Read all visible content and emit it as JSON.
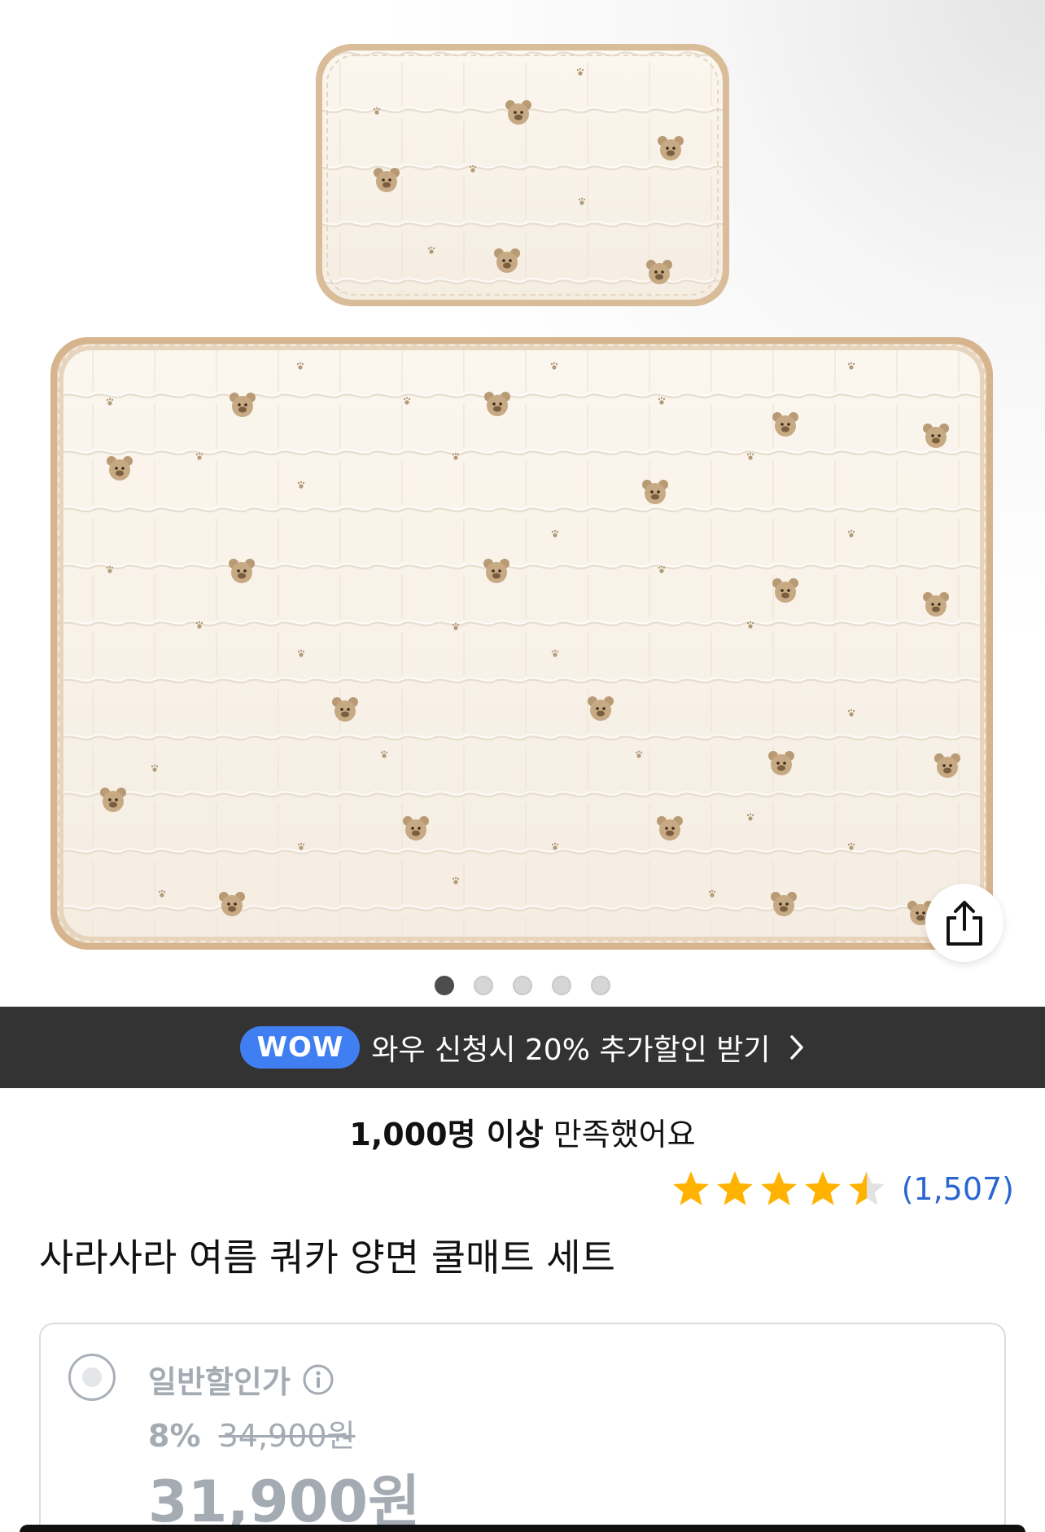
{
  "gallery": {
    "image_alt": "Product photo of a bear-pattern quilted cool mat set with pillow cover",
    "slide_count": 5,
    "active_slide": 1,
    "share_icon": "share-icon"
  },
  "wow_banner": {
    "badge": "WOW",
    "text": "와우 신청시 20% 추가할인 받기",
    "badge_color": "#3f7ff2",
    "chevron_icon": "chevron-right-icon"
  },
  "satisfaction": {
    "bold": "1,000명 이상",
    "rest": "만족했어요"
  },
  "rating": {
    "value": 4.5,
    "max": 5,
    "review_count": "(1,507)",
    "star_color": "#ffb300"
  },
  "product": {
    "title": "사라사라 여름 쿼카 양면 쿨매트 세트"
  },
  "price_option": {
    "label": "일반할인가",
    "info_icon": "info-icon",
    "discount_rate": "8%",
    "original_price": "34,900원",
    "final_price": "31,900원"
  }
}
